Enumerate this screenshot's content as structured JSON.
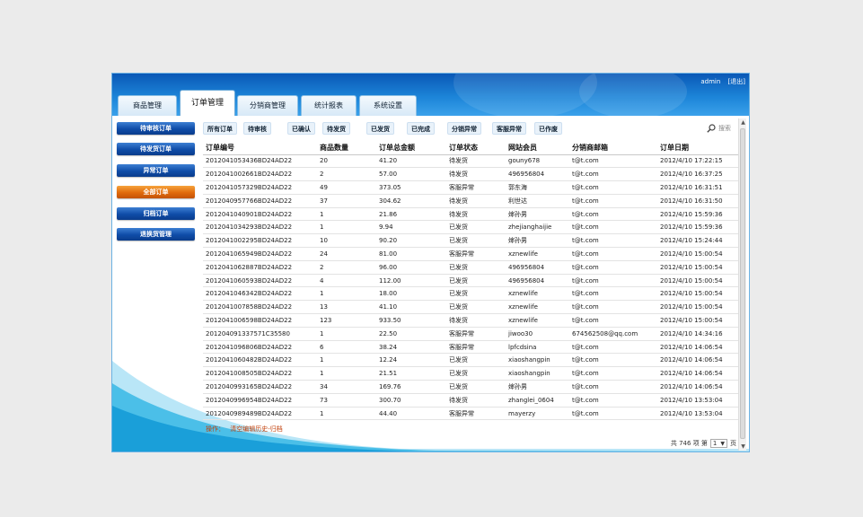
{
  "top_links": {
    "user": "admin",
    "logout": "[退出]"
  },
  "tabs": [
    {
      "label": "商品管理",
      "name": "tab-product-management"
    },
    {
      "label": "订单管理",
      "name": "tab-order-management"
    },
    {
      "label": "分销商管理",
      "name": "tab-distributor-management"
    },
    {
      "label": "统计报表",
      "name": "tab-statistics-reports"
    },
    {
      "label": "系统设置",
      "name": "tab-system-settings"
    }
  ],
  "active_tab": 1,
  "sidebar": [
    {
      "label": "待审核订单",
      "name": "sidebar-pending-review"
    },
    {
      "label": "待发货订单",
      "name": "sidebar-pending-shipment"
    },
    {
      "label": "异常订单",
      "name": "sidebar-abnormal-orders"
    },
    {
      "label": "全部订单",
      "name": "sidebar-all-orders"
    },
    {
      "label": "归档订单",
      "name": "sidebar-archived-orders"
    },
    {
      "label": "退换货管理",
      "name": "sidebar-returns-management"
    }
  ],
  "active_sidebar": 3,
  "filters": [
    "所有订单",
    "待审核",
    "已确认",
    "待发货",
    "已发货",
    "已完成",
    "分销异常",
    "客服异常",
    "已作废"
  ],
  "search": {
    "label": "搜索"
  },
  "table": {
    "headers": [
      "订单编号",
      "商品数量",
      "订单总金额",
      "订单状态",
      "网站会员",
      "分销商邮箱",
      "订单日期"
    ],
    "rows": [
      [
        "2012041053436BD24AD22",
        "20",
        "41.20",
        "待发货",
        "gouny678",
        "t@t.com",
        "2012/4/10 17:22:15"
      ],
      [
        "2012041002661BD24AD22",
        "2",
        "57.00",
        "待发货",
        "496956804",
        "t@t.com",
        "2012/4/10 16:37:25"
      ],
      [
        "2012041057329BD24AD22",
        "49",
        "373.05",
        "客服异常",
        "郭东海",
        "t@t.com",
        "2012/4/10 16:31:51"
      ],
      [
        "2012040957766BD24AD22",
        "37",
        "304.62",
        "待发货",
        "利世达",
        "t@t.com",
        "2012/4/10 16:31:50"
      ],
      [
        "2012041040901BD24AD22",
        "1",
        "21.86",
        "待发货",
        "婶孙男",
        "t@t.com",
        "2012/4/10 15:59:36"
      ],
      [
        "2012041034293BD24AD22",
        "1",
        "9.94",
        "已发货",
        "zhejianghaijie",
        "t@t.com",
        "2012/4/10 15:59:36"
      ],
      [
        "2012041002295BD24AD22",
        "10",
        "90.20",
        "已发货",
        "婶孙男",
        "t@t.com",
        "2012/4/10 15:24:44"
      ],
      [
        "2012041065949BD24AD22",
        "24",
        "81.00",
        "客服异常",
        "xznewlife",
        "t@t.com",
        "2012/4/10 15:00:54"
      ],
      [
        "2012041062887BD24AD22",
        "2",
        "96.00",
        "已发货",
        "496956804",
        "t@t.com",
        "2012/4/10 15:00:54"
      ],
      [
        "2012041060593BD24AD22",
        "4",
        "112.00",
        "已发货",
        "496956804",
        "t@t.com",
        "2012/4/10 15:00:54"
      ],
      [
        "2012041046342BD24AD22",
        "1",
        "18.00",
        "已发货",
        "xznewlife",
        "t@t.com",
        "2012/4/10 15:00:54"
      ],
      [
        "2012041007858BD24AD22",
        "13",
        "41.10",
        "已发货",
        "xznewlife",
        "t@t.com",
        "2012/4/10 15:00:54"
      ],
      [
        "2012041006598BD24AD22",
        "123",
        "933.50",
        "待发货",
        "xznewlife",
        "t@t.com",
        "2012/4/10 15:00:54"
      ],
      [
        "201204091337571C35580",
        "1",
        "22.50",
        "客服异常",
        "jiwoo30",
        "674562508@qq.com",
        "2012/4/10 14:34:16"
      ],
      [
        "2012041096806BD24AD22",
        "6",
        "38.24",
        "客服异常",
        "lpfcdsina",
        "t@t.com",
        "2012/4/10 14:06:54"
      ],
      [
        "2012041060482BD24AD22",
        "1",
        "12.24",
        "已发货",
        "xiaoshangpin",
        "t@t.com",
        "2012/4/10 14:06:54"
      ],
      [
        "2012041008505BD24AD22",
        "1",
        "21.51",
        "已发货",
        "xiaoshangpin",
        "t@t.com",
        "2012/4/10 14:06:54"
      ],
      [
        "2012040993165BD24AD22",
        "34",
        "169.76",
        "已发货",
        "婶孙男",
        "t@t.com",
        "2012/4/10 14:06:54"
      ],
      [
        "2012040996954BD24AD22",
        "73",
        "300.70",
        "待发货",
        "zhanglei_0604",
        "t@t.com",
        "2012/4/10 13:53:04"
      ],
      [
        "2012040989489BD24AD22",
        "1",
        "44.40",
        "客服异常",
        "mayerzy",
        "t@t.com",
        "2012/4/10 13:53:04"
      ]
    ]
  },
  "ops": {
    "label": "操作：",
    "link": "清空编辑历史-归档"
  },
  "pager": {
    "prefix": "共 746 项 第",
    "page": "1",
    "suffix": "页"
  }
}
